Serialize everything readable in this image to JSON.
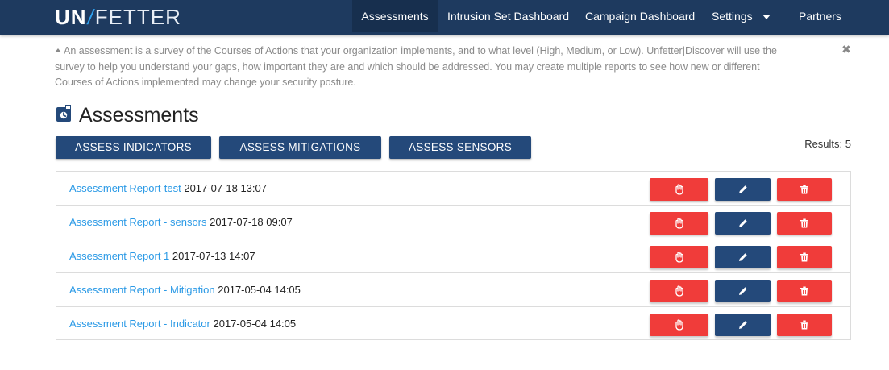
{
  "brand": {
    "bold": "UN",
    "slash": "/",
    "rest": "FETTER"
  },
  "nav": {
    "items": [
      {
        "label": "Assessments",
        "active": true
      },
      {
        "label": "Intrusion Set Dashboard"
      },
      {
        "label": "Campaign Dashboard"
      },
      {
        "label": "Settings",
        "has_dropdown": true
      },
      {
        "label": "Partners"
      }
    ]
  },
  "info": {
    "text": "An assessment is a survey of the Courses of Actions that your organization implements, and to what level (High, Medium, or Low). Unfetter|Discover will use the survey to help you understand your gaps, how important they are and which should be addressed. You may create multiple reports to see how new or different Courses of Actions implemented may change your security posture.",
    "close_icon": "close-icon"
  },
  "page": {
    "title": "Assessments",
    "title_icon": "assessment-icon",
    "results_label": "Results: 5"
  },
  "actions": {
    "assess_indicators": "ASSESS INDICATORS",
    "assess_mitigations": "ASSESS MITIGATIONS",
    "assess_sensors": "ASSESS SENSORS"
  },
  "reports": [
    {
      "name": "Assessment Report-test",
      "date": "2017-07-18 13:07"
    },
    {
      "name": "Assessment Report - sensors",
      "date": "2017-07-18 09:07"
    },
    {
      "name": "Assessment Report 1",
      "date": "2017-07-13 14:07"
    },
    {
      "name": "Assessment Report - Mitigation",
      "date": "2017-05-04 14:05"
    },
    {
      "name": "Assessment Report - Indicator",
      "date": "2017-05-04 14:05"
    }
  ],
  "colors": {
    "navbar": "#1e3a5f",
    "primary_button": "#24497a",
    "danger_button": "#f03c3a",
    "link": "#2b9ae6"
  }
}
